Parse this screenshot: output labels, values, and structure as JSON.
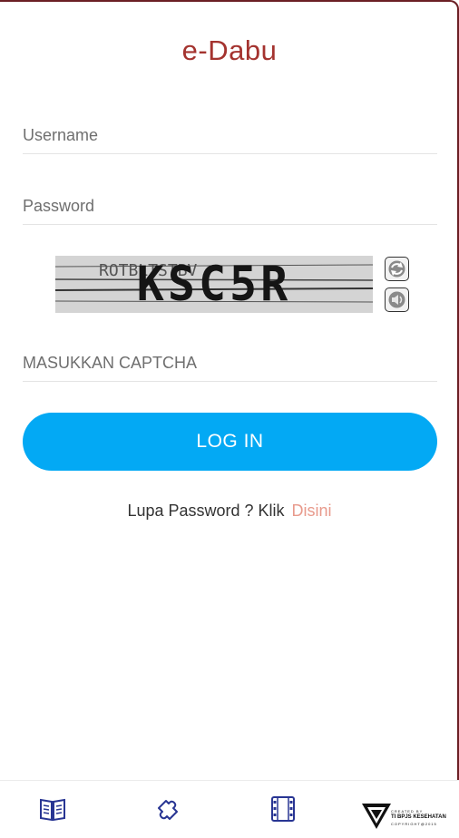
{
  "app": {
    "title": "e-Dabu"
  },
  "form": {
    "username": {
      "value": "",
      "placeholder": "Username"
    },
    "password": {
      "value": "",
      "placeholder": "Password"
    },
    "captcha": {
      "image_text": "KSC5R",
      "input_value": "",
      "input_placeholder": "MASUKKAN CAPTCHA",
      "refresh_icon": "refresh-icon",
      "audio_icon": "speaker-icon"
    },
    "login_label": "LOG IN"
  },
  "forgot": {
    "text": "Lupa Password ? Klik",
    "link_label": "Disini"
  },
  "bottom_nav": {
    "items": [
      {
        "name": "book-icon"
      },
      {
        "name": "puzzle-icon"
      },
      {
        "name": "film-icon"
      }
    ],
    "brand": {
      "created_by": "CREATED BY",
      "org": "TI BPJS KESEHATAN",
      "copyright": "COPYRIGHT@2015"
    }
  },
  "colors": {
    "title": "#a4332f",
    "login_button": "#03a9f4",
    "link": "#e89a8c",
    "nav_icon": "#283593"
  }
}
